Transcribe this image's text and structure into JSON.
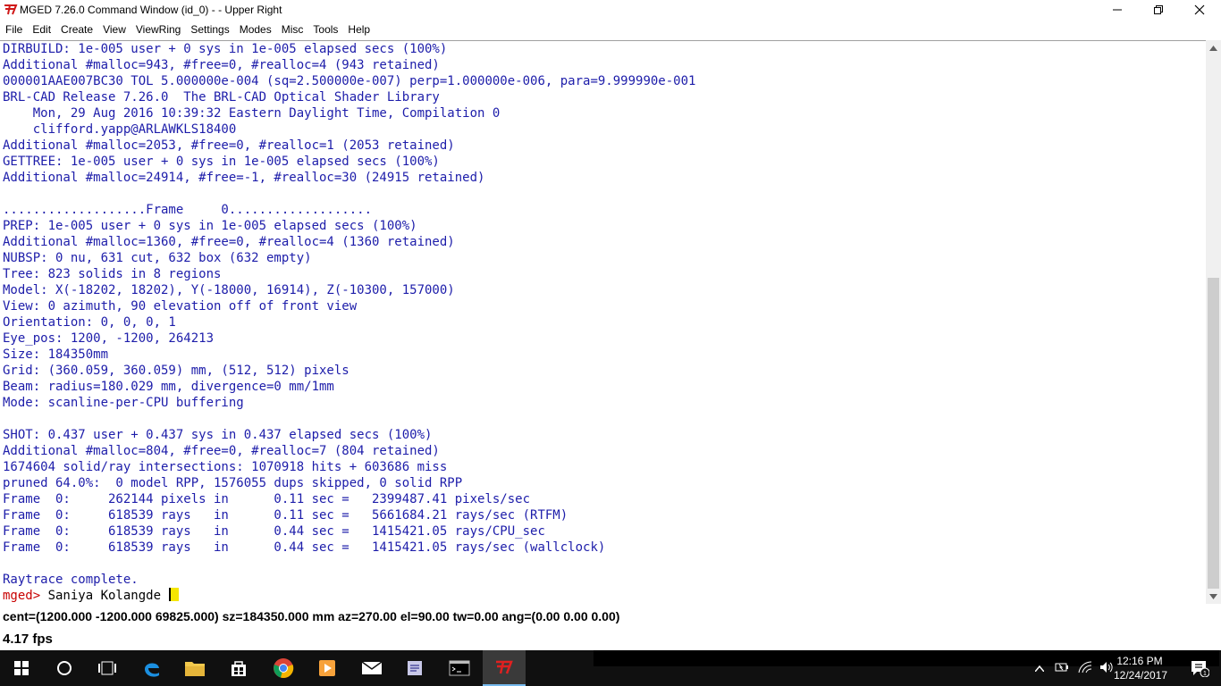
{
  "window": {
    "title": "MGED 7.26.0 Command Window (id_0) -  - Upper Right",
    "app_icon": "brlcad-logo-icon",
    "controls": [
      "minimize-icon",
      "restore-icon",
      "close-icon"
    ]
  },
  "menu": [
    {
      "label": "File"
    },
    {
      "label": "Edit"
    },
    {
      "label": "Create"
    },
    {
      "label": "View"
    },
    {
      "label": "ViewRing"
    },
    {
      "label": "Settings"
    },
    {
      "label": "Modes"
    },
    {
      "label": "Misc"
    },
    {
      "label": "Tools"
    },
    {
      "label": "Help"
    }
  ],
  "console": {
    "lines": [
      "DIRBUILD: 1e-005 user + 0 sys in 1e-005 elapsed secs (100%)",
      "Additional #malloc=943, #free=0, #realloc=4 (943 retained)",
      "000001AAE007BC30 TOL 5.000000e-004 (sq=2.500000e-007) perp=1.000000e-006, para=9.999990e-001",
      "BRL-CAD Release 7.26.0  The BRL-CAD Optical Shader Library",
      "    Mon, 29 Aug 2016 10:39:32 Eastern Daylight Time, Compilation 0",
      "    clifford.yapp@ARLAWKLS18400",
      "Additional #malloc=2053, #free=0, #realloc=1 (2053 retained)",
      "GETTREE: 1e-005 user + 0 sys in 1e-005 elapsed secs (100%)",
      "Additional #malloc=24914, #free=-1, #realloc=30 (24915 retained)",
      "",
      "...................Frame     0...................",
      "PREP: 1e-005 user + 0 sys in 1e-005 elapsed secs (100%)",
      "Additional #malloc=1360, #free=0, #realloc=4 (1360 retained)",
      "NUBSP: 0 nu, 631 cut, 632 box (632 empty)",
      "Tree: 823 solids in 8 regions",
      "Model: X(-18202, 18202), Y(-18000, 16914), Z(-10300, 157000)",
      "View: 0 azimuth, 90 elevation off of front view",
      "Orientation: 0, 0, 0, 1",
      "Eye_pos: 1200, -1200, 264213",
      "Size: 184350mm",
      "Grid: (360.059, 360.059) mm, (512, 512) pixels",
      "Beam: radius=180.029 mm, divergence=0 mm/1mm",
      "Mode: scanline-per-CPU buffering",
      "",
      "SHOT: 0.437 user + 0.437 sys in 0.437 elapsed secs (100%)",
      "Additional #malloc=804, #free=0, #realloc=7 (804 retained)",
      "1674604 solid/ray intersections: 1070918 hits + 603686 miss",
      "pruned 64.0%:  0 model RPP, 1576055 dups skipped, 0 solid RPP",
      "Frame  0:     262144 pixels in      0.11 sec =   2399487.41 pixels/sec",
      "Frame  0:     618539 rays   in      0.11 sec =   5661684.21 rays/sec (RTFM)",
      "Frame  0:     618539 rays   in      0.44 sec =   1415421.05 rays/CPU_sec",
      "Frame  0:     618539 rays   in      0.44 sec =   1415421.05 rays/sec (wallclock)",
      "",
      "Raytrace complete."
    ],
    "prompt": "mged> ",
    "command_input": "Saniya Kolangde "
  },
  "status": {
    "view_info": "cent=(1200.000 -1200.000 69825.000) sz=184350.000  mm  az=270.00  el=90.00  tw=0.00  ang=(0.00 0.00 0.00)",
    "fps": "4.17 fps"
  },
  "taskbar": {
    "items": [
      {
        "name": "start-windows-icon"
      },
      {
        "name": "search-circle-icon"
      },
      {
        "name": "task-view-icon"
      },
      {
        "name": "edge-browser-icon"
      },
      {
        "name": "file-explorer-icon"
      },
      {
        "name": "store-icon"
      },
      {
        "name": "chrome-icon"
      },
      {
        "name": "media-player-icon"
      },
      {
        "name": "mail-icon"
      },
      {
        "name": "document-app-icon"
      },
      {
        "name": "terminal-icon"
      },
      {
        "name": "brlcad-taskbar-icon"
      }
    ],
    "time": "12:16 PM",
    "date": "12/24/2017",
    "notification_count": "1"
  }
}
